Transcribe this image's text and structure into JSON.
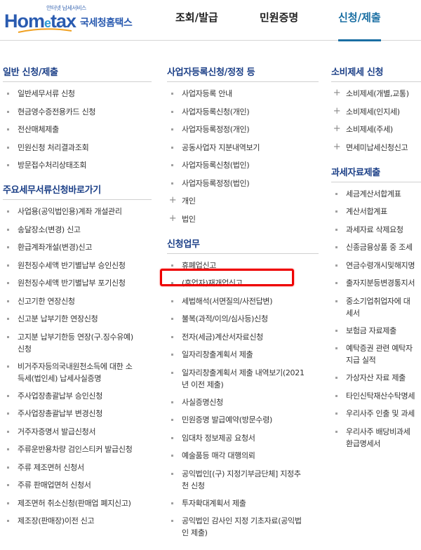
{
  "header": {
    "logo_tagline": "안터넷 납세서비스",
    "logo_word_a": "Hom",
    "logo_word_e": "e",
    "logo_word_b": "tax",
    "logo_korean": "국세청홈택스",
    "nav": [
      {
        "label": "조회/발급",
        "active": false
      },
      {
        "label": "민원증명",
        "active": false
      },
      {
        "label": "신청/제출",
        "active": true
      }
    ]
  },
  "colors": {
    "title": "#1b3f87",
    "nav_active": "#1a6fa3",
    "highlight": "#e00000"
  },
  "col1": {
    "sections": [
      {
        "title": "일반 신청/제출",
        "items": [
          {
            "label": "일반세무서류 신청",
            "bullet": "square"
          },
          {
            "label": "현금영수증전용카드 신청",
            "bullet": "square"
          },
          {
            "label": "전산매체제출",
            "bullet": "square"
          },
          {
            "label": "민원신청 처리결과조회",
            "bullet": "square"
          },
          {
            "label": "방문접수처리상태조회",
            "bullet": "square"
          }
        ]
      },
      {
        "title": "주요세무서류신청바로가기",
        "items": [
          {
            "label": "사업용(공익법인용)계좌 개설관리",
            "bullet": "square"
          },
          {
            "label": "송달장소(변경) 신고",
            "bullet": "square"
          },
          {
            "label": "환급계좌개설(변경)신고",
            "bullet": "square"
          },
          {
            "label": "원천징수세액 반기별납부 승인신청",
            "bullet": "square"
          },
          {
            "label": "원천징수세액 반기별납부 포기신청",
            "bullet": "square"
          },
          {
            "label": "신고기한 연장신청",
            "bullet": "square"
          },
          {
            "label": "신고분 납부기한 연장신청",
            "bullet": "square"
          },
          {
            "label": "고지분 납부기한등 연장(구.징수유예)\n신청",
            "bullet": "square"
          },
          {
            "label": "비거주자등의국내원천소득에 대한 소\n득세(법인세) 납세사실증명",
            "bullet": "square"
          },
          {
            "label": "주사업장총괄납부 승인신청",
            "bullet": "square"
          },
          {
            "label": "주사업장총괄납부 변경신청",
            "bullet": "square"
          },
          {
            "label": "거주자증명서 발급신청서",
            "bullet": "square"
          },
          {
            "label": "주류운반용차량 검인스티커 발급신청",
            "bullet": "square"
          },
          {
            "label": "주류 제조면허 신청서",
            "bullet": "square"
          },
          {
            "label": "주류 판매업면허 신청서",
            "bullet": "square"
          },
          {
            "label": "제조면허 취소신청(판매업 폐지신고)",
            "bullet": "square"
          },
          {
            "label": "제조장(판매장)이전 신고",
            "bullet": "square"
          }
        ]
      }
    ]
  },
  "col2": {
    "sections": [
      {
        "title": "사업자등록신청/정정 등",
        "items": [
          {
            "label": "사업자등록 안내",
            "bullet": "square"
          },
          {
            "label": "사업자등록신청(개인)",
            "bullet": "square"
          },
          {
            "label": "사업자등록정정(개인)",
            "bullet": "square"
          },
          {
            "label": "공동사업자 지분내역보기",
            "bullet": "square"
          },
          {
            "label": "사업자등록신청(법인)",
            "bullet": "square"
          },
          {
            "label": "사업자등록정정(법인)",
            "bullet": "square"
          },
          {
            "label": "개인",
            "bullet": "plus"
          },
          {
            "label": "법인",
            "bullet": "plus"
          }
        ]
      },
      {
        "title": "신청업무",
        "items": [
          {
            "label": "휴폐업신고",
            "bullet": "square"
          },
          {
            "label": "(휴업자)재개업신고",
            "bullet": "square"
          },
          {
            "label": "세법해석(서면질의/사전답변)",
            "bullet": "square"
          },
          {
            "label": "불복(과적/이의/심사등)신청",
            "bullet": "square"
          },
          {
            "label": "전자(세금)계산서자료신청",
            "bullet": "square"
          },
          {
            "label": "일자리창출계획서 제출",
            "bullet": "square"
          },
          {
            "label": "일자리창출계획서 제출 내역보기(2021\n년 이전 제출)",
            "bullet": "square"
          },
          {
            "label": "사실증명신청",
            "bullet": "square"
          },
          {
            "label": "민원증명 발급예약(방문수령)",
            "bullet": "square"
          },
          {
            "label": "임대차 정보제공 요청서",
            "bullet": "square"
          },
          {
            "label": "예술품등 매각 대행의뢰",
            "bullet": "square"
          },
          {
            "label": "공익법인[(구) 지정기부금단체] 지정추\n천 신청",
            "bullet": "square"
          },
          {
            "label": "투자확대계획서 제출",
            "bullet": "square"
          },
          {
            "label": "공익법인 감사인 지정 기초자료(공익법\n인 제출)",
            "bullet": "square"
          }
        ]
      }
    ]
  },
  "col3": {
    "sections": [
      {
        "title": "소비제세 신청",
        "items": [
          {
            "label": "소비제세(개별,교통)",
            "bullet": "plus"
          },
          {
            "label": "소비제세(인지세)",
            "bullet": "plus"
          },
          {
            "label": "소비제세(주세)",
            "bullet": "plus"
          },
          {
            "label": "면세미납세신청신고",
            "bullet": "plus"
          }
        ]
      },
      {
        "title": "과세자료제출",
        "items": [
          {
            "label": "세금계산서합계표",
            "bullet": "square"
          },
          {
            "label": "계산서합계표",
            "bullet": "square"
          },
          {
            "label": "과세자료 삭제요청",
            "bullet": "square"
          },
          {
            "label": "신종금융상품 중 조세",
            "bullet": "square"
          },
          {
            "label": "연금수령개시및해지명",
            "bullet": "square"
          },
          {
            "label": "출자지분등변경통지서",
            "bullet": "square"
          },
          {
            "label": "중소기업취업자에 대\n세서",
            "bullet": "square"
          },
          {
            "label": "보험금 자료제출",
            "bullet": "square"
          },
          {
            "label": "예탁증권 관련 예탁자\n지급 실적",
            "bullet": "square"
          },
          {
            "label": "가상자산 자료 제출",
            "bullet": "square"
          },
          {
            "label": "타인신탁재산수탁명세",
            "bullet": "square"
          },
          {
            "label": "우리사주 인출 및 과세",
            "bullet": "square"
          },
          {
            "label": "우리사주 배당비과세\n환급명세서",
            "bullet": "square"
          }
        ]
      }
    ]
  }
}
